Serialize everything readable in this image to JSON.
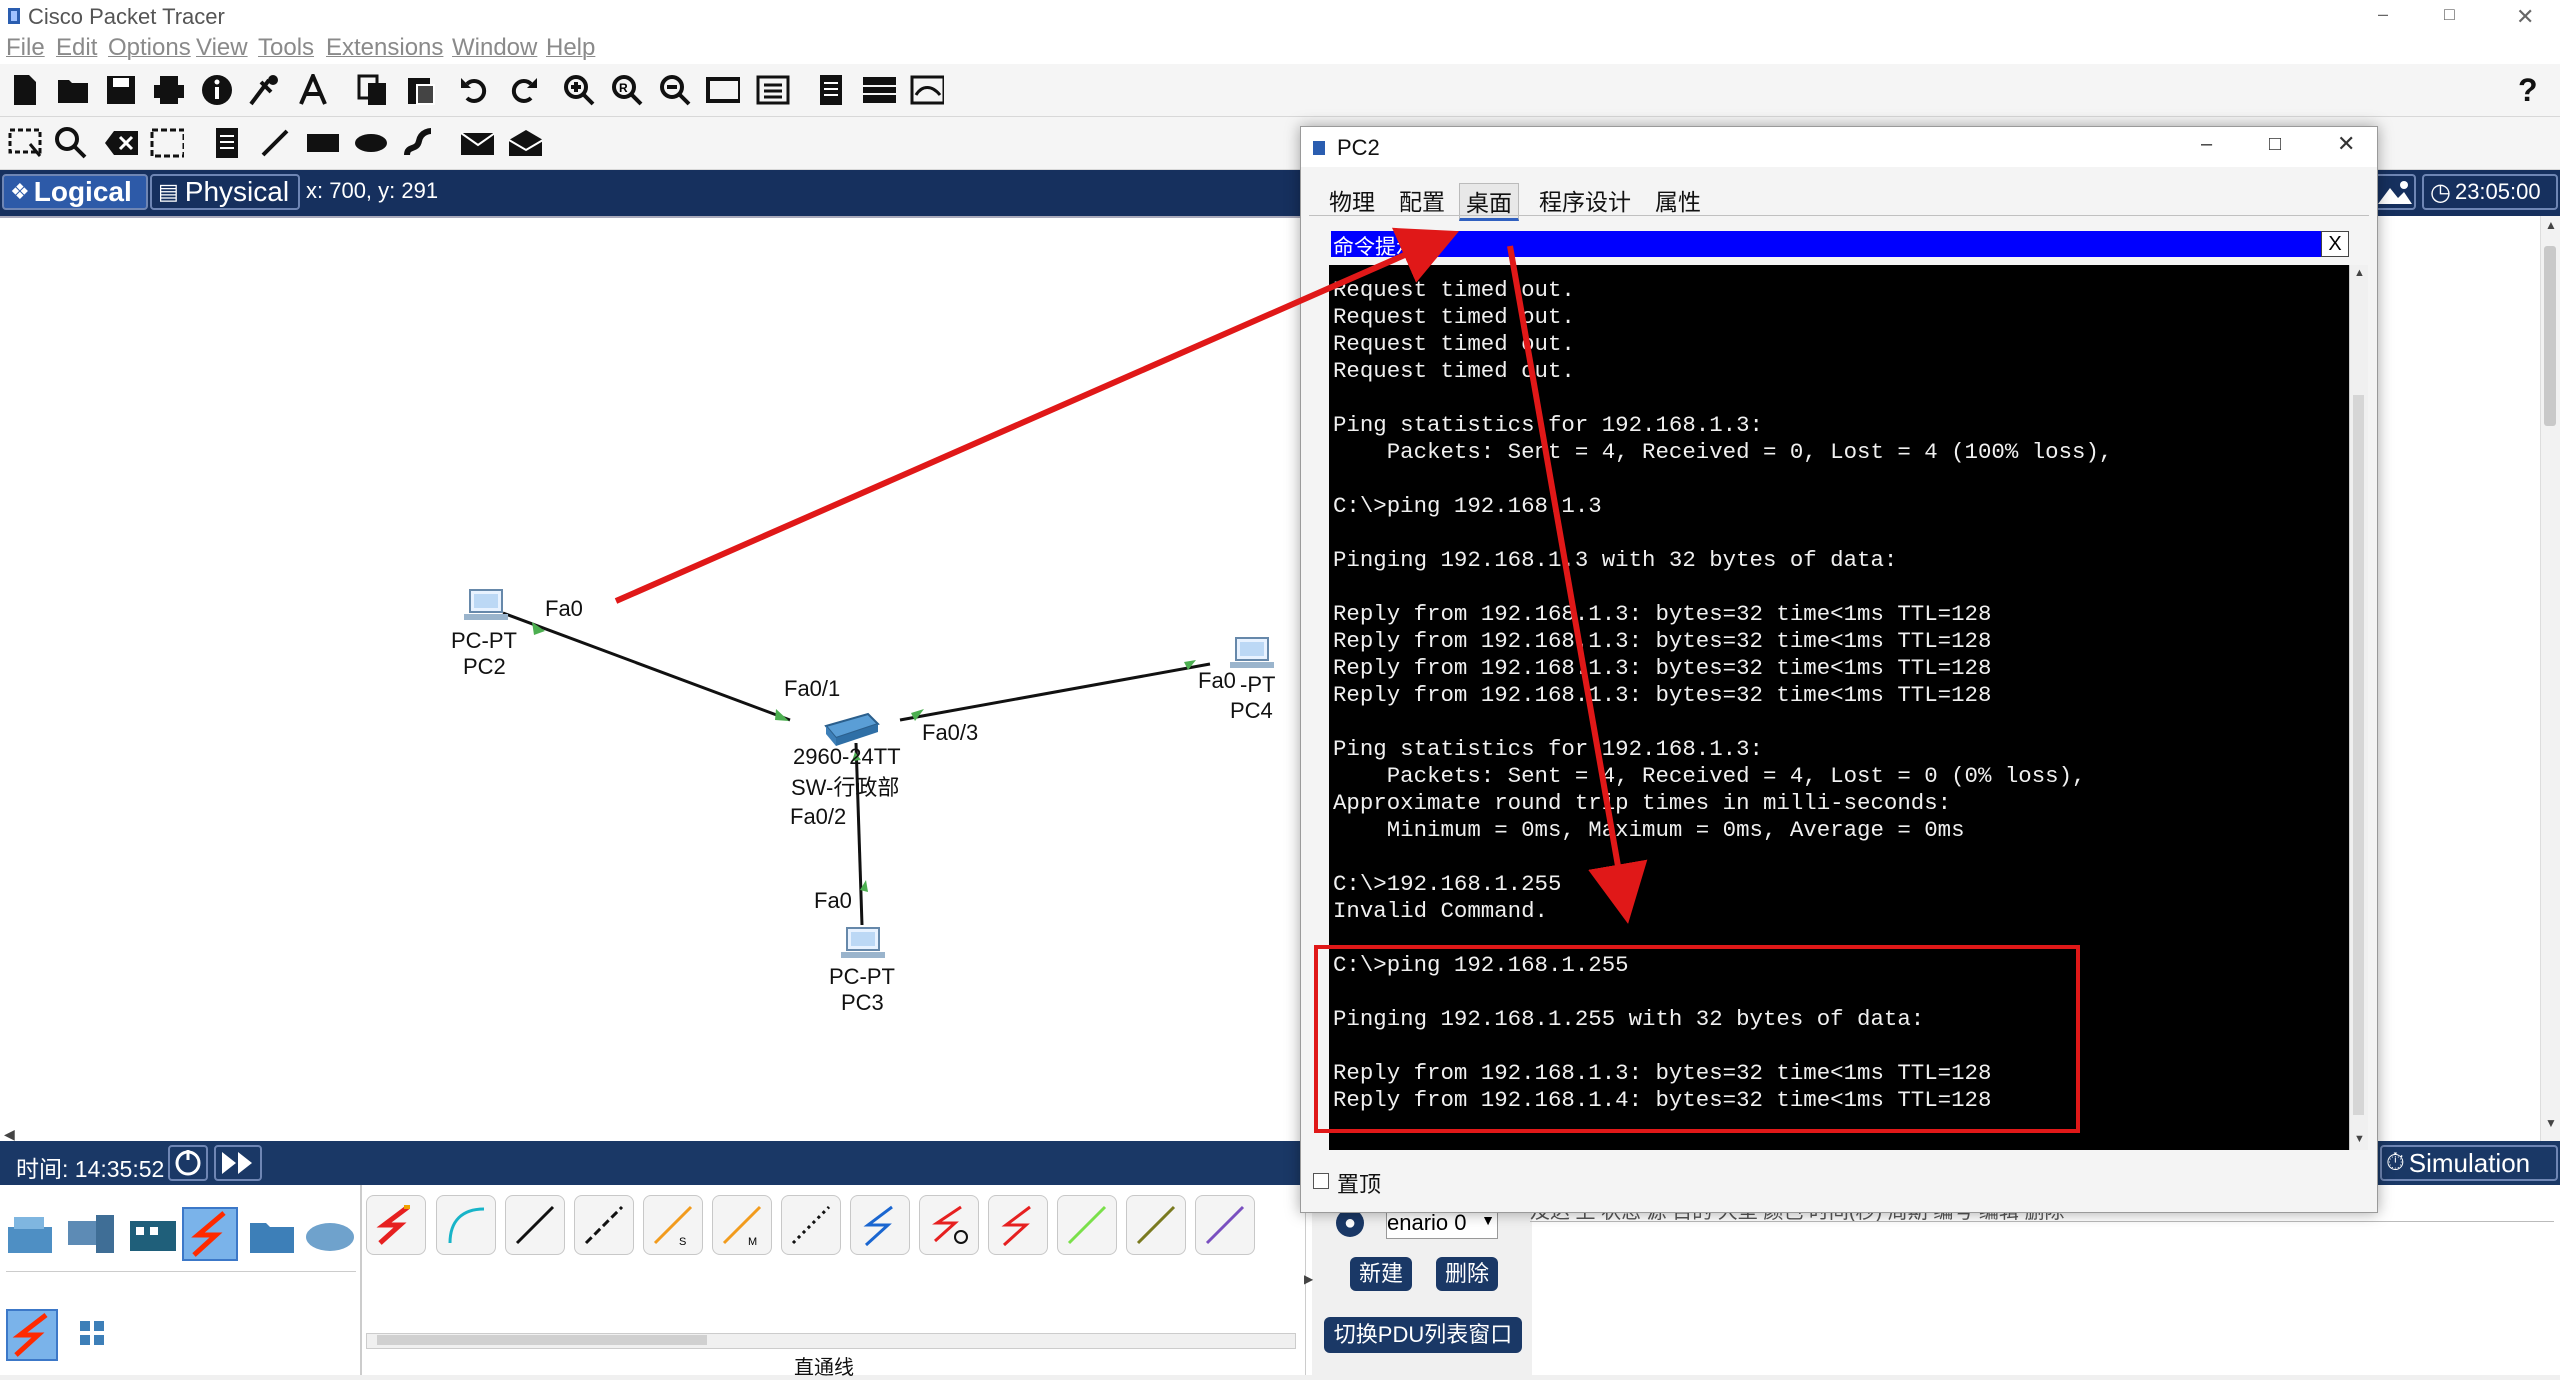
{
  "app": {
    "title": "Cisco Packet Tracer",
    "menu": [
      "File",
      "Edit",
      "Options",
      "View",
      "Tools",
      "Extensions",
      "Window",
      "Help"
    ],
    "help_glyph": "?"
  },
  "toolbar1_icons": [
    "new-file-icon",
    "open-folder-icon",
    "save-icon",
    "print-icon",
    "info-icon",
    "network-wizard-icon",
    "activity-wizard-icon",
    "copy-icon",
    "paste-icon",
    "undo-icon",
    "redo-icon",
    "zoom-in-icon",
    "zoom-reset-icon",
    "zoom-out-icon",
    "drawing-palette-icon",
    "custom-device-icon",
    "notes-icon",
    "cluster-icon",
    "viewport-icon"
  ],
  "toolbar2_icons": [
    "select-icon",
    "inspect-icon",
    "delete-icon",
    "resize-icon",
    "note-icon",
    "line-icon",
    "rectangle-icon",
    "ellipse-icon",
    "freeform-icon",
    "simple-pdu-icon",
    "complex-pdu-icon"
  ],
  "logical_bar": {
    "logical_label": "Logical",
    "physical_label": "Physical",
    "coords": "x: 700, y: 291",
    "clock": "23:05:00"
  },
  "topology": {
    "pc2": {
      "type": "PC-PT",
      "name": "PC2",
      "port": "Fa0"
    },
    "pc3": {
      "type": "PC-PT",
      "name": "PC3",
      "port": "Fa0"
    },
    "pc4": {
      "type": "-PT",
      "name": "PC4",
      "port": "Fa0"
    },
    "switch": {
      "model": "2960-24TT",
      "name": "SW-行政部",
      "port1": "Fa0/1",
      "port2": "Fa0/2",
      "port3": "Fa0/3"
    }
  },
  "timebar": {
    "time_label": "时间: 14:35:52",
    "simulation_label": "Simulation"
  },
  "device_panel": {
    "cable_caption": "直通线"
  },
  "pdu_panel": {
    "scenario": "enario 0",
    "new_label": "新建",
    "delete_label": "删除",
    "switch_label": "切换PDU列表窗口",
    "header_text": "及达  上  状态  源    目的  大型  颜色  时间(秒) 周期  编号  编辑  删除"
  },
  "pc_window": {
    "title": "PC2",
    "tabs": [
      "物理",
      "配置",
      "桌面",
      "程序设计",
      "属性"
    ],
    "active_tab": "桌面",
    "cmd_title": "命令提示符",
    "cmd_close": "X",
    "topmost_label": "置顶",
    "terminal_text": "Request timed out.\nRequest timed out.\nRequest timed out.\nRequest timed out.\n\nPing statistics for 192.168.1.3:\n    Packets: Sent = 4, Received = 0, Lost = 4 (100% loss),\n\nC:\\>ping 192.168.1.3\n\nPinging 192.168.1.3 with 32 bytes of data:\n\nReply from 192.168.1.3: bytes=32 time<1ms TTL=128\nReply from 192.168.1.3: bytes=32 time<1ms TTL=128\nReply from 192.168.1.3: bytes=32 time<1ms TTL=128\nReply from 192.168.1.3: bytes=32 time<1ms TTL=128\n\nPing statistics for 192.168.1.3:\n    Packets: Sent = 4, Received = 4, Lost = 0 (0% loss),\nApproximate round trip times in milli-seconds:\n    Minimum = 0ms, Maximum = 0ms, Average = 0ms\n\nC:\\>192.168.1.255\nInvalid Command.\n\nC:\\>ping 192.168.1.255\n\nPinging 192.168.1.255 with 32 bytes of data:\n\nReply from 192.168.1.3: bytes=32 time<1ms TTL=128\nReply from 192.168.1.4: bytes=32 time<1ms TTL=128"
  },
  "colors": {
    "accent_blue": "#16305e",
    "cmd_header": "#0000ff",
    "annotation_red": "#e01818",
    "link_green": "#4caf50"
  }
}
